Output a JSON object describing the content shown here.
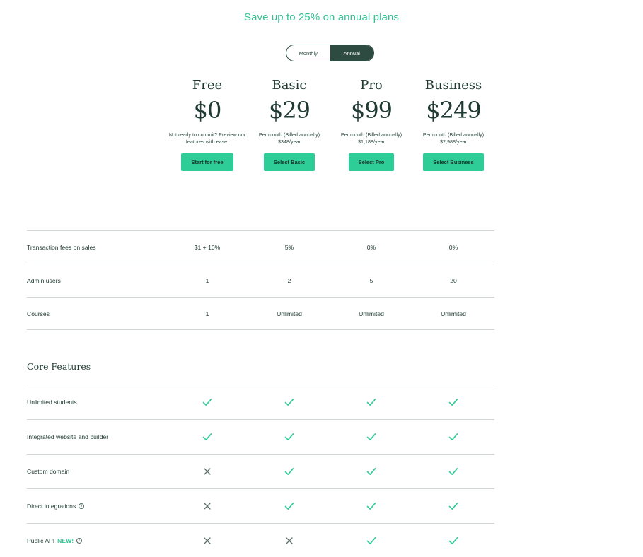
{
  "promo": "Save up to 25% on annual plans",
  "billing_toggle": {
    "monthly": "Monthly",
    "annual": "Annual",
    "selected": "Annual"
  },
  "plans": [
    {
      "name": "Free",
      "price": "$0",
      "note_line1": "Not ready to commit? Preview our",
      "note_line2": "features with ease.",
      "button": "Start for free"
    },
    {
      "name": "Basic",
      "price": "$29",
      "note_line1": "Per month (Billed annually)",
      "note_line2": "$348/year",
      "button": "Select Basic"
    },
    {
      "name": "Pro",
      "price": "$99",
      "note_line1": "Per month (Billed annually)",
      "note_line2": "$1,188/year",
      "button": "Select Pro"
    },
    {
      "name": "Business",
      "price": "$249",
      "note_line1": "Per month (Billed annually)",
      "note_line2": "$2,988/year",
      "button": "Select Business"
    }
  ],
  "limits": [
    {
      "label": "Transaction fees on sales",
      "values": [
        "$1 + 10%",
        "5%",
        "0%",
        "0%"
      ]
    },
    {
      "label": "Admin users",
      "values": [
        "1",
        "2",
        "5",
        "20"
      ]
    },
    {
      "label": "Courses",
      "values": [
        "1",
        "Unlimited",
        "Unlimited",
        "Unlimited"
      ]
    }
  ],
  "core_features": {
    "title": "Core Features",
    "rows": [
      {
        "label": "Unlimited students",
        "info": false,
        "badge": "",
        "values": [
          "check",
          "check",
          "check",
          "check"
        ]
      },
      {
        "label": "Integrated website and builder",
        "info": false,
        "badge": "",
        "values": [
          "check",
          "check",
          "check",
          "check"
        ]
      },
      {
        "label": "Custom domain",
        "info": false,
        "badge": "",
        "values": [
          "cross",
          "check",
          "check",
          "check"
        ]
      },
      {
        "label": "Direct integrations",
        "info": true,
        "badge": "",
        "values": [
          "cross",
          "check",
          "check",
          "check"
        ]
      },
      {
        "label": "Public API",
        "info": true,
        "badge": "NEW!",
        "values": [
          "cross",
          "cross",
          "check",
          "check"
        ]
      }
    ]
  },
  "colors": {
    "accent": "#2ecc97",
    "promo": "#35c194",
    "dark": "#2d4b40",
    "cross": "#5b6f68"
  },
  "icons": {
    "check": "check-icon",
    "cross": "cross-icon",
    "info": "info-icon"
  }
}
